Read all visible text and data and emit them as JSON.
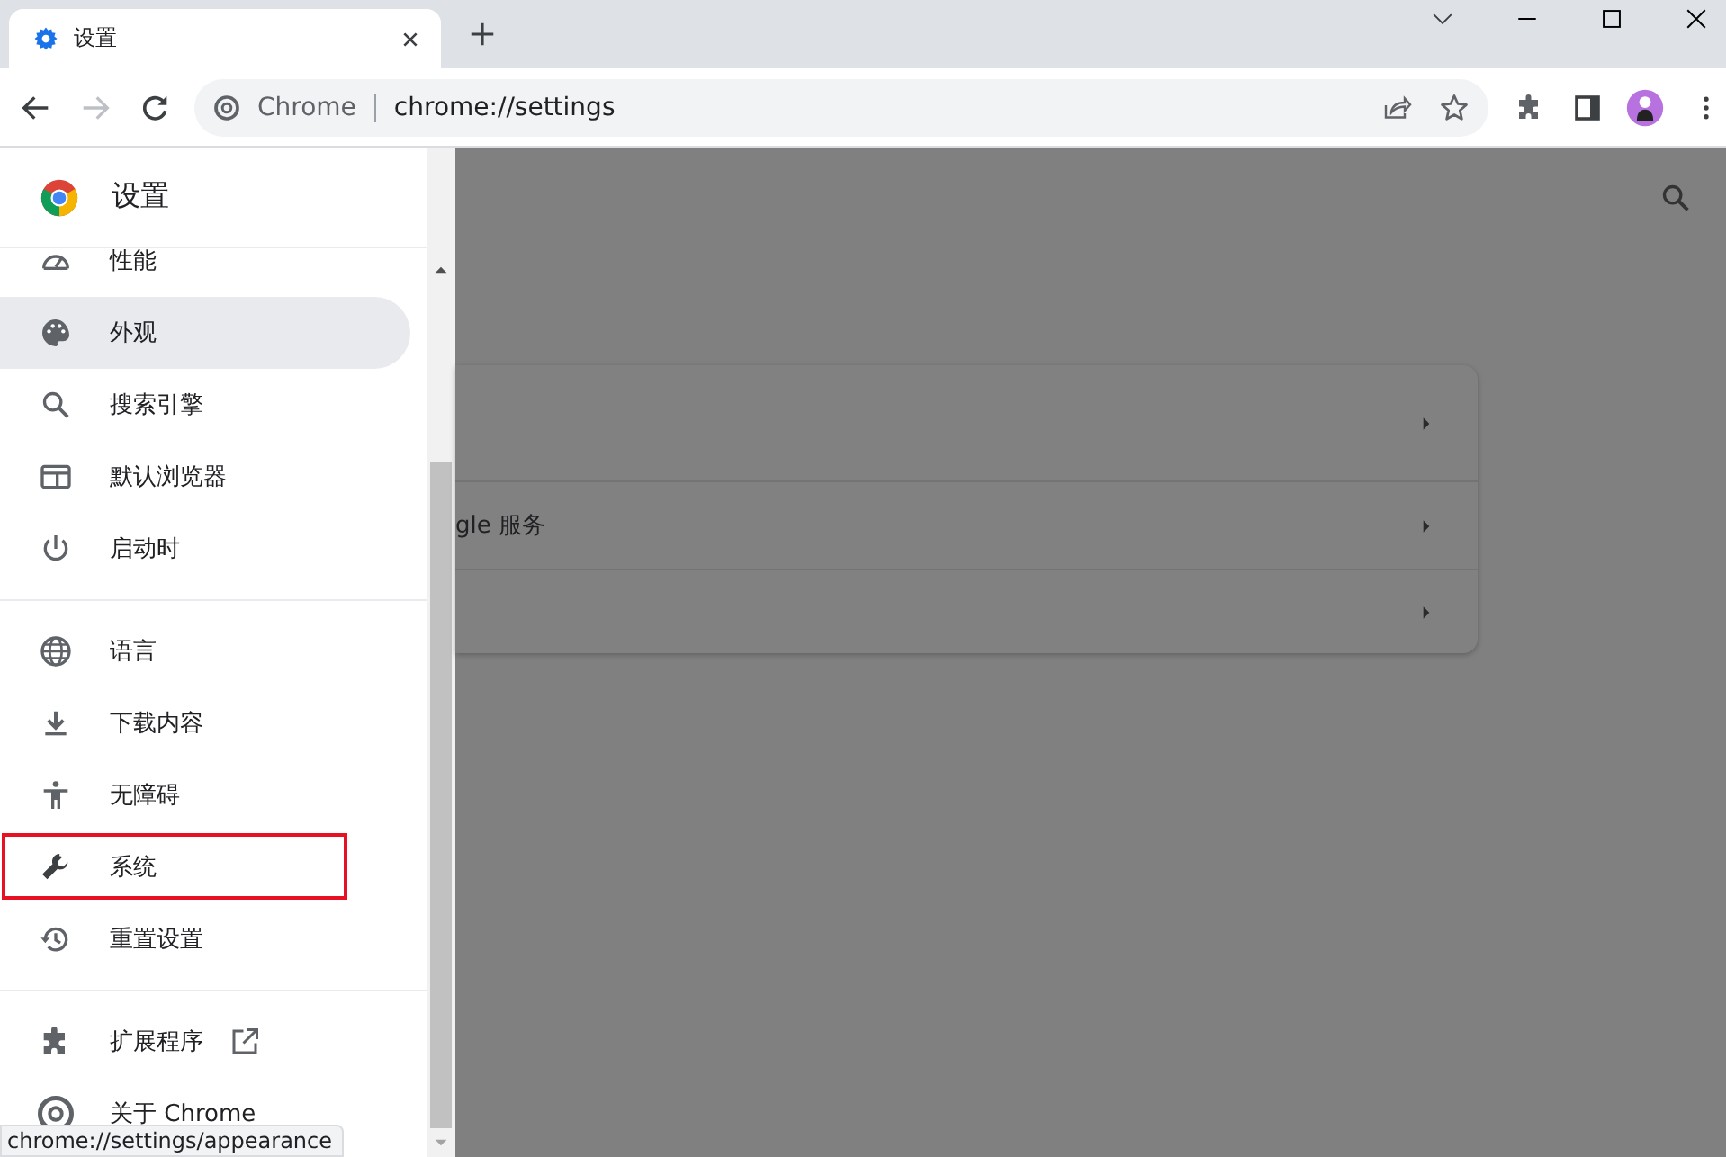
{
  "window": {
    "tab": {
      "title": "设置"
    }
  },
  "toolbar": {
    "forward_disabled": true,
    "omnibox": {
      "site_label": "Chrome",
      "url": "chrome://settings"
    }
  },
  "sidebar": {
    "title": "设置",
    "groups": [
      {
        "items": [
          {
            "label": "性能",
            "selected": false,
            "highlighted": false,
            "external_link": false
          },
          {
            "label": "外观",
            "selected": true,
            "highlighted": false,
            "external_link": false
          },
          {
            "label": "搜索引擎",
            "selected": false,
            "highlighted": false,
            "external_link": false
          },
          {
            "label": "默认浏览器",
            "selected": false,
            "highlighted": false,
            "external_link": false
          },
          {
            "label": "启动时",
            "selected": false,
            "highlighted": false,
            "external_link": false
          }
        ]
      },
      {
        "items": [
          {
            "label": "语言",
            "selected": false,
            "highlighted": false,
            "external_link": false
          },
          {
            "label": "下载内容",
            "selected": false,
            "highlighted": false,
            "external_link": false
          },
          {
            "label": "无障碍",
            "selected": false,
            "highlighted": false,
            "external_link": false
          },
          {
            "label": "系统",
            "selected": false,
            "highlighted": true,
            "external_link": false
          },
          {
            "label": "重置设置",
            "selected": false,
            "highlighted": false,
            "external_link": false
          }
        ]
      },
      {
        "items": [
          {
            "label": "扩展程序",
            "selected": false,
            "highlighted": false,
            "external_link": true
          },
          {
            "label": "关于 Chrome",
            "selected": false,
            "highlighted": false,
            "external_link": false
          }
        ]
      }
    ]
  },
  "page": {
    "card_rows": [
      {
        "arrow": true
      },
      {
        "label": "gle 服务",
        "arrow": true
      },
      {
        "arrow": true
      }
    ]
  },
  "status_bubble": "chrome://settings/appearance"
}
